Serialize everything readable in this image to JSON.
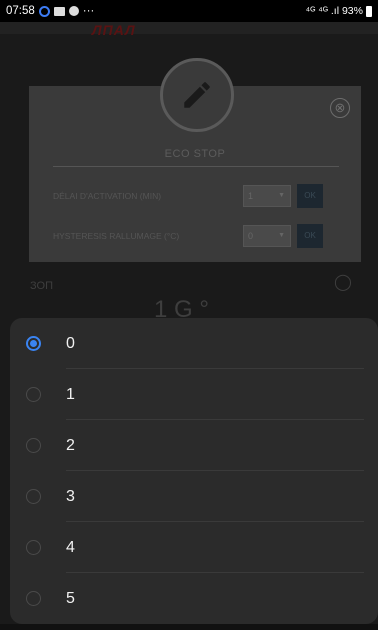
{
  "status_bar": {
    "time": "07:58",
    "extra": "···",
    "right": "⁴ᴳ ⁴ᴳ .ıl 93%"
  },
  "background": {
    "logo_text": "ЛПАЛ",
    "dialog": {
      "title": "ECO STOP",
      "rows": [
        {
          "label": "DÉLAI D'ACTIVATION (MIN)",
          "value": "1",
          "ok": "OK"
        },
        {
          "label": "HYSTERESIS RALLUMAGE (°C)",
          "value": "0",
          "ok": "OK"
        }
      ],
      "close_symbol": "⊗"
    },
    "left_text": "ЗОП",
    "right_symbol": "◯",
    "big_value": "1 G °"
  },
  "sheet": {
    "options": [
      {
        "label": "0",
        "selected": true
      },
      {
        "label": "1",
        "selected": false
      },
      {
        "label": "2",
        "selected": false
      },
      {
        "label": "3",
        "selected": false
      },
      {
        "label": "4",
        "selected": false
      },
      {
        "label": "5",
        "selected": false
      }
    ]
  },
  "colors": {
    "accent": "#3a84f2",
    "sheet_bg": "#2b2b2b",
    "status_icon": "#3d7cf4"
  },
  "icons": {
    "edit": "pencil-icon",
    "close": "close-circle-icon"
  }
}
